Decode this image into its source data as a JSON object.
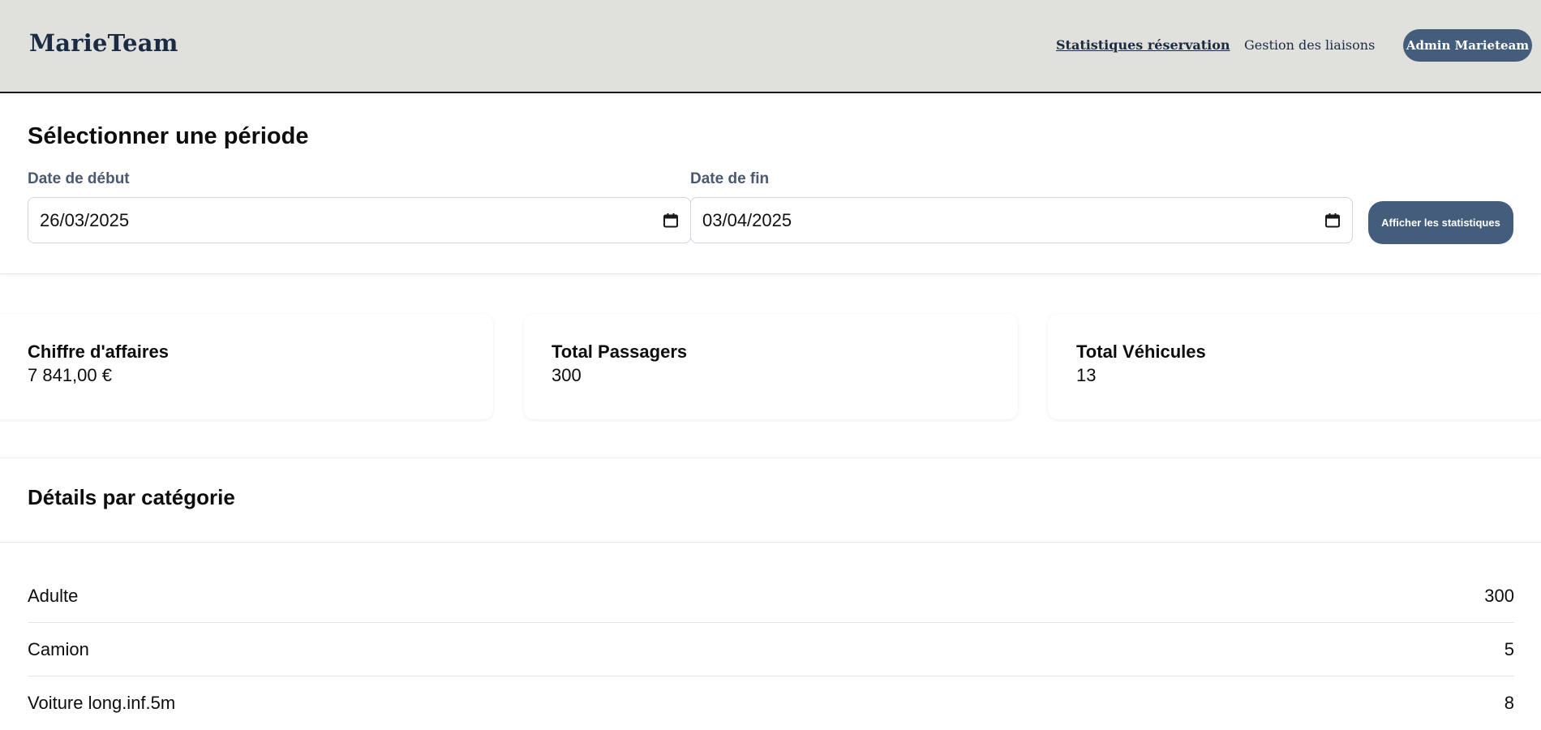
{
  "header": {
    "brand": "MarieTeam",
    "nav": {
      "stats_label": "Statistiques réservation",
      "liaisons_label": "Gestion des liaisons"
    },
    "user_label": "Admin Marieteam"
  },
  "period": {
    "title": "Sélectionner une période",
    "start": {
      "label": "Date de début",
      "value": "26/03/2025",
      "icon": "calendar-icon"
    },
    "end": {
      "label": "Date de fin",
      "value": "03/04/2025",
      "icon": "calendar-icon"
    },
    "submit_label": "Afficher les statistiques"
  },
  "stats": [
    {
      "title": "Chiffre d'affaires",
      "value": "7 841,00 €"
    },
    {
      "title": "Total Passagers",
      "value": "300"
    },
    {
      "title": "Total Véhicules",
      "value": "13"
    }
  ],
  "details": {
    "title": "Détails par catégorie",
    "rows": [
      {
        "name": "Adulte",
        "value": "300"
      },
      {
        "name": "Camion",
        "value": "5"
      },
      {
        "name": "Voiture long.inf.5m",
        "value": "8"
      }
    ]
  },
  "colors": {
    "header_bg": "#e0e0dc",
    "brand_text": "#1c2b44",
    "accent": "#445d7c",
    "label_text": "#4a5870"
  }
}
